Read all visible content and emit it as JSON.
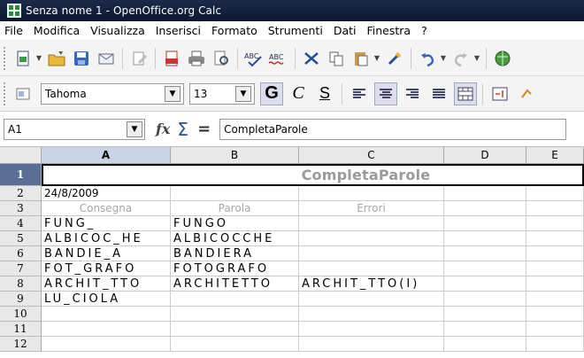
{
  "window": {
    "title": "Senza nome 1 - OpenOffice.org Calc"
  },
  "menu": [
    "File",
    "Modifica",
    "Visualizza",
    "Inserisci",
    "Formato",
    "Strumenti",
    "Dati",
    "Finestra",
    "?"
  ],
  "toolbar_standard": {
    "icons": [
      "new-document-icon",
      "open-folder-icon",
      "save-icon",
      "email-icon",
      "edit-file-icon",
      "export-pdf-icon",
      "print-icon",
      "page-preview-icon",
      "spellcheck-icon",
      "autospellcheck-icon",
      "cut-icon",
      "copy-icon",
      "paste-icon",
      "clone-format-icon",
      "undo-icon",
      "redo-icon",
      "navigator-icon"
    ]
  },
  "toolbar_format": {
    "font_name": "Tahoma",
    "font_size": "13",
    "bold_label": "G",
    "italic_label": "C",
    "underline_label": "S"
  },
  "formula_bar": {
    "cell_ref": "A1",
    "fx": "fx",
    "sigma": "Σ",
    "equals": "=",
    "content": "CompletaParole"
  },
  "grid": {
    "columns": [
      "A",
      "B",
      "C",
      "D",
      "E"
    ],
    "rows": [
      "1",
      "2",
      "3",
      "4",
      "5",
      "6",
      "7",
      "8",
      "9",
      "10",
      "11",
      "12"
    ],
    "title": "CompletaParole",
    "date": "24/8/2009",
    "headers": [
      "Consegna",
      "Parola",
      "Errori"
    ],
    "data": [
      [
        "FUNG_",
        "FUNGO",
        ""
      ],
      [
        "ALBICOC_HE",
        "ALBICOCCHE",
        ""
      ],
      [
        "BANDIE_A",
        "BANDIERA",
        ""
      ],
      [
        "FOT_GRAFO",
        "FOTOGRAFO",
        ""
      ],
      [
        "ARCHIT_TTO",
        "ARCHITETTO",
        "ARCHIT_TTO(I)"
      ],
      [
        "LU_CIOLA",
        "",
        ""
      ]
    ]
  }
}
